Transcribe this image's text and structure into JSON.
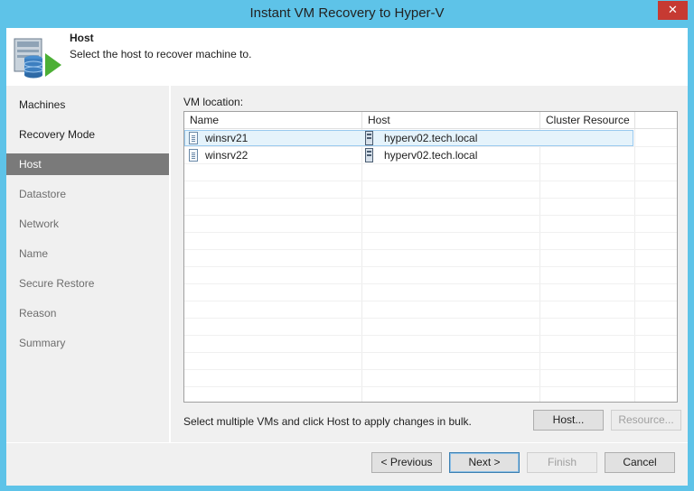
{
  "window": {
    "title": "Instant VM Recovery to Hyper-V",
    "close_glyph": "✕"
  },
  "header": {
    "title": "Host",
    "subtitle": "Select the host to recover machine to."
  },
  "sidebar": {
    "items": [
      {
        "label": "Machines",
        "state": "normal"
      },
      {
        "label": "Recovery Mode",
        "state": "normal"
      },
      {
        "label": "Host",
        "state": "active"
      },
      {
        "label": "Datastore",
        "state": "muted"
      },
      {
        "label": "Network",
        "state": "muted"
      },
      {
        "label": "Name",
        "state": "muted"
      },
      {
        "label": "Secure Restore",
        "state": "muted"
      },
      {
        "label": "Reason",
        "state": "muted"
      },
      {
        "label": "Summary",
        "state": "muted"
      }
    ]
  },
  "main": {
    "vm_location_label": "VM location:",
    "table": {
      "columns": [
        "Name",
        "Host",
        "Cluster Resource"
      ],
      "rows": [
        {
          "name": "winsrv21",
          "host": "hyperv02.tech.local",
          "cluster_resource": "",
          "selected": true
        },
        {
          "name": "winsrv22",
          "host": "hyperv02.tech.local",
          "cluster_resource": "",
          "selected": false
        }
      ]
    },
    "hint": "Select multiple VMs and click Host to apply changes in bulk.",
    "host_button": "Host...",
    "resource_button": "Resource..."
  },
  "footer": {
    "previous": "< Previous",
    "next": "Next >",
    "finish": "Finish",
    "cancel": "Cancel"
  },
  "colors": {
    "frame": "#5ec3e8",
    "close": "#c63a32",
    "active_nav": "#7a7a7a",
    "selection": "#e5f3fb"
  }
}
